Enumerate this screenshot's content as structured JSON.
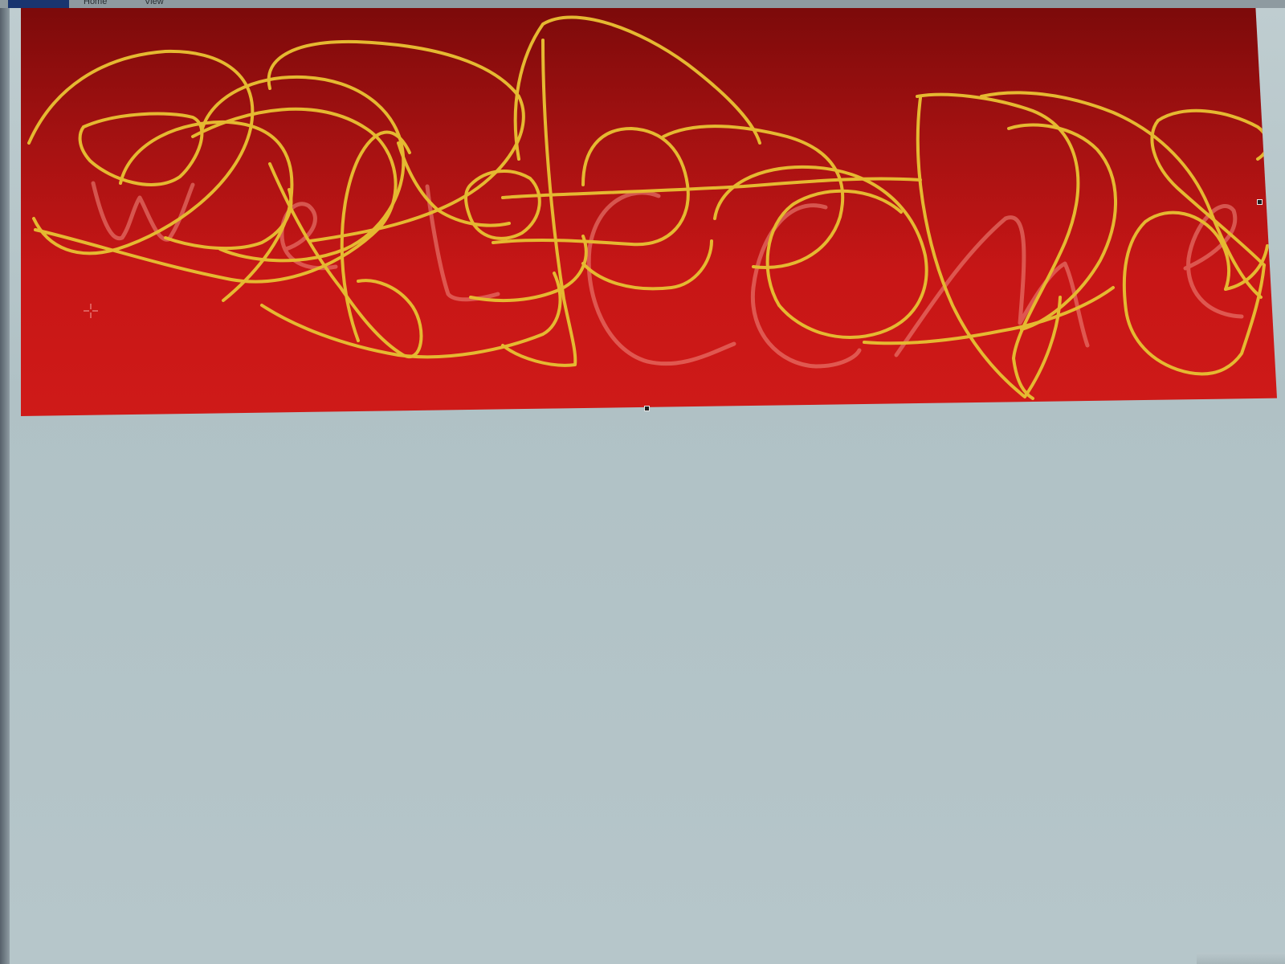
{
  "ribbon": {
    "file_label": "",
    "tabs": [
      {
        "label": "Home"
      },
      {
        "label": "View"
      }
    ]
  },
  "canvas": {
    "background_color": "#c71616",
    "stroke_color": "#e8c23a",
    "ghost_text_color": "#f1877a",
    "ghost_text": "welcome"
  },
  "icons": {
    "cursor": "crosshair-icon"
  }
}
